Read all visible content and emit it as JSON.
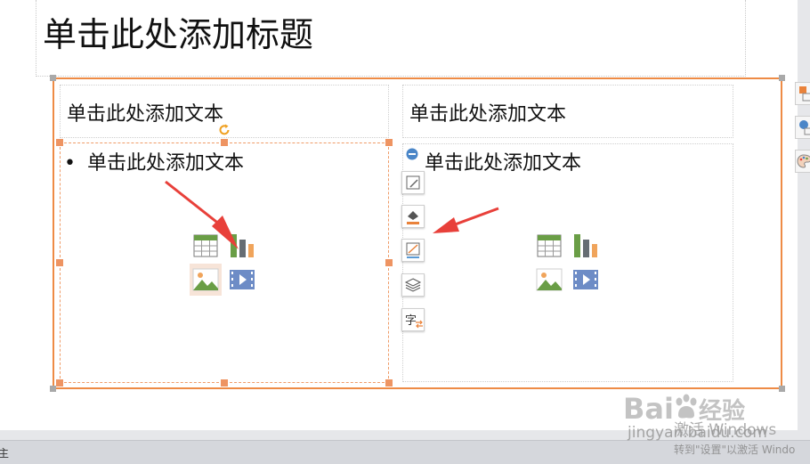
{
  "slide": {
    "title_placeholder": "单击此处添加标题",
    "left": {
      "heading_placeholder": "单击此处添加文本",
      "bullet_placeholder": "单击此处添加文本",
      "bullet_symbol": "•"
    },
    "right": {
      "heading_placeholder": "单击此处添加文本",
      "bullet_placeholder": "单击此处添加文本"
    }
  },
  "minitoolbar": {
    "items": [
      {
        "name": "edit-shape-icon"
      },
      {
        "name": "fill-color-icon"
      },
      {
        "name": "outline-color-icon"
      },
      {
        "name": "arrange-layers-icon"
      },
      {
        "name": "text-direction-icon",
        "glyph": "字"
      }
    ]
  },
  "status": {
    "left_text": "主"
  },
  "watermark": {
    "brand": "Bai",
    "brand2": "经验",
    "url": "jingyan.baidu.com",
    "activate_line1": "激活 Windows",
    "activate_line2": "转到\"设置\"以激活 Windo"
  },
  "colors": {
    "selection": "#ee8b45",
    "handle": "#ee9462",
    "arrow": "#e8403a",
    "table_green": "#6a9e46",
    "chart_gray": "#666d73",
    "chart_orange": "#f0a45b",
    "media_blue": "#6d8cc6"
  }
}
